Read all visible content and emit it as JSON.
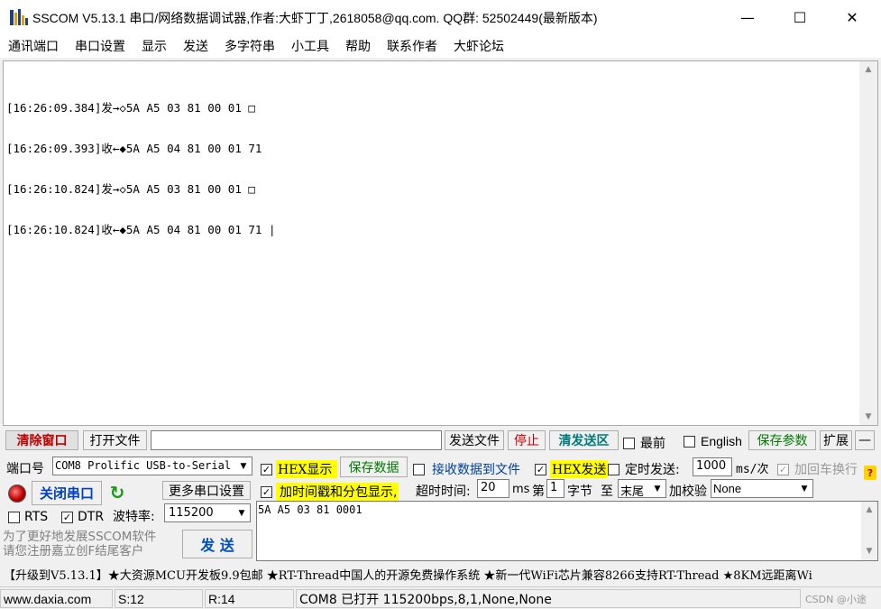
{
  "window": {
    "title": "SSCOM V5.13.1 串口/网络数据调试器,作者:大虾丁丁,2618058@qq.com. QQ群: 52502449(最新版本)",
    "minimize": "—",
    "maximize": "☐",
    "close": "✕"
  },
  "menu": [
    "通讯端口",
    "串口设置",
    "显示",
    "发送",
    "多字符串",
    "小工具",
    "帮助",
    "联系作者",
    "大虾论坛"
  ],
  "receive": {
    "lines": [
      "[16:26:09.384]发→◇5A A5 03 81 00 01 □",
      "[16:26:09.393]收←◆5A A5 04 81 00 01 71",
      "[16:26:10.824]发→◇5A A5 03 81 00 01 □",
      "[16:26:10.824]收←◆5A A5 04 81 00 01 71 |"
    ]
  },
  "toolbar": {
    "clear_window": "清除窗口",
    "open_file": "打开文件",
    "send_file": "发送文件",
    "stop": "停止",
    "clear_send": "清发送区",
    "topmost": "最前",
    "english": "English",
    "save_params": "保存参数",
    "expand": "扩展",
    "collapse": "—"
  },
  "port": {
    "port_label": "端口号",
    "port_value": "COM8 Prolific USB-to-Serial",
    "close_port": "关闭串口",
    "more_settings": "更多串口设置",
    "rts": "RTS",
    "dtr": "DTR",
    "baud_label": "波特率:",
    "baud_value": "115200"
  },
  "options": {
    "hex_display": "HEX显示",
    "save_data": "保存数据",
    "recv_to_file": "接收数据到文件",
    "hex_send": "HEX发送",
    "timed_send": "定时发送:",
    "timed_value": "1000",
    "timed_unit": "ms/次",
    "add_crlf": "加回车换行",
    "timestamp": "加时间戳和分包显示,",
    "timeout_label": "超时时间:",
    "timeout_value": "20",
    "timeout_unit": "ms",
    "byte_from_pre": "第",
    "byte_from_value": "1",
    "byte_unit": "字节",
    "to_label": "至",
    "to_value": "末尾",
    "checksum_label": "加校验",
    "checksum_value": "None"
  },
  "send": {
    "text": "5A A5 03 81 0001",
    "button": "发  送",
    "promo_line1": "为了更好地发展SSCOM软件",
    "promo_line2": "请您注册嘉立创F结尾客户"
  },
  "ticker": "【升级到V5.13.1】★大资源MCU开发板9.9包邮 ★RT-Thread中国人的开源免费操作系统 ★新一代WiFi芯片兼容8266支持RT-Thread ★8KM远距离Wi",
  "status": {
    "website": "www.daxia.com",
    "sent": "S:12",
    "received": "R:14",
    "port_state": "COM8 已打开  115200bps,8,1,None,None",
    "watermark": "CSDN @小途"
  }
}
